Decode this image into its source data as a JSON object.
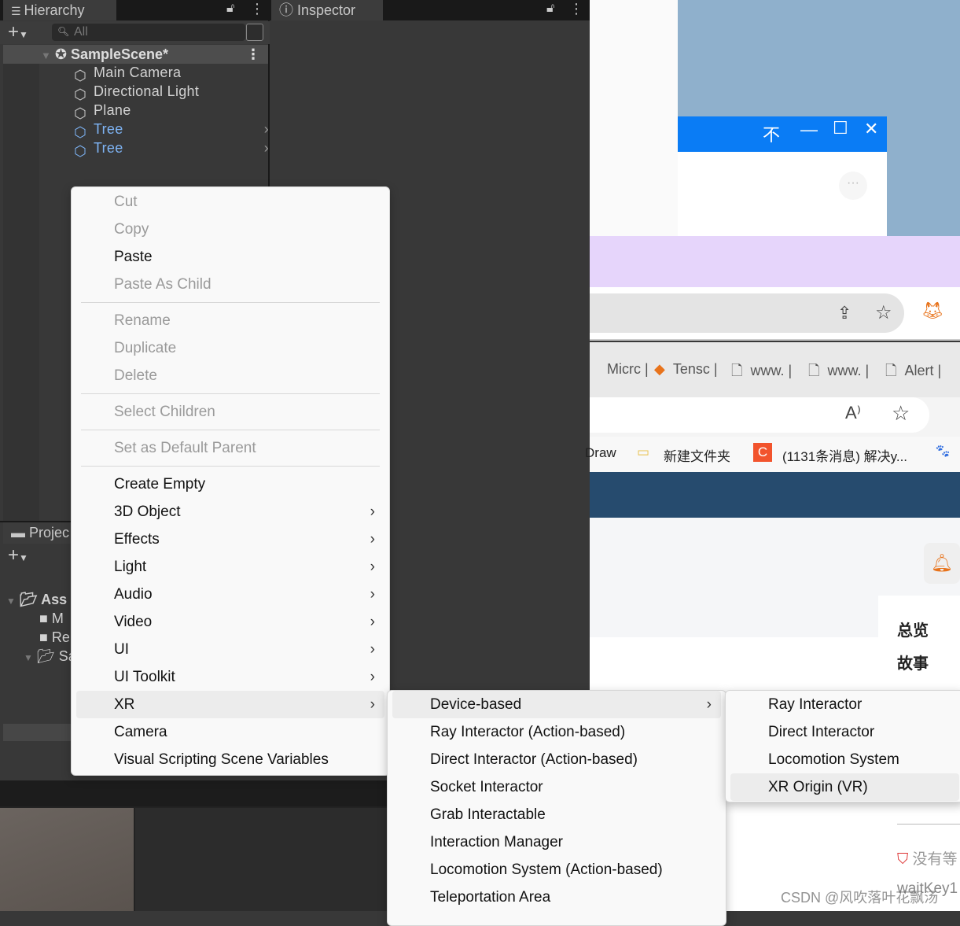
{
  "unity": {
    "hierarchy_tab": "Hierarchy",
    "inspector_tab": "Inspector",
    "search_placeholder": "All",
    "scene": "SampleScene*",
    "items": [
      {
        "label": "Main Camera",
        "prefab": false
      },
      {
        "label": "Directional Light",
        "prefab": false
      },
      {
        "label": "Plane",
        "prefab": false
      },
      {
        "label": "Tree",
        "prefab": true
      },
      {
        "label": "Tree",
        "prefab": true
      }
    ],
    "project_tab": "Projec",
    "project_items": [
      "Ass",
      "M",
      "Re",
      "Sa"
    ]
  },
  "context_menu": [
    {
      "label": "Cut",
      "disabled": true
    },
    {
      "label": "Copy",
      "disabled": true
    },
    {
      "label": "Paste"
    },
    {
      "label": "Paste As Child",
      "disabled": true
    },
    {
      "sep": true
    },
    {
      "label": "Rename",
      "disabled": true
    },
    {
      "label": "Duplicate",
      "disabled": true
    },
    {
      "label": "Delete",
      "disabled": true
    },
    {
      "sep": true
    },
    {
      "label": "Select Children",
      "disabled": true
    },
    {
      "sep": true
    },
    {
      "label": "Set as Default Parent",
      "disabled": true
    },
    {
      "sep": true
    },
    {
      "label": "Create Empty"
    },
    {
      "label": "3D Object",
      "submenu": true
    },
    {
      "label": "Effects",
      "submenu": true
    },
    {
      "label": "Light",
      "submenu": true
    },
    {
      "label": "Audio",
      "submenu": true
    },
    {
      "label": "Video",
      "submenu": true
    },
    {
      "label": "UI",
      "submenu": true
    },
    {
      "label": "UI Toolkit",
      "submenu": true
    },
    {
      "label": "XR",
      "submenu": true,
      "highlighted": true
    },
    {
      "label": "Camera"
    },
    {
      "label": "Visual Scripting Scene Variables"
    }
  ],
  "xr_menu": [
    {
      "label": "Device-based",
      "submenu": true,
      "highlighted": true
    },
    {
      "label": "Ray Interactor (Action-based)"
    },
    {
      "label": "Direct Interactor (Action-based)"
    },
    {
      "label": "Socket Interactor"
    },
    {
      "label": "Grab Interactable"
    },
    {
      "label": "Interaction Manager"
    },
    {
      "label": "Locomotion System (Action-based)"
    },
    {
      "label": "Teleportation Area"
    }
  ],
  "device_menu": [
    {
      "label": "Ray Interactor"
    },
    {
      "label": "Direct Interactor"
    },
    {
      "label": "Locomotion System"
    },
    {
      "label": "XR Origin (VR)",
      "highlighted": true
    }
  ],
  "browser": {
    "tabs": [
      "Micrc",
      "Tensc",
      "www.",
      "www.",
      "Alert"
    ],
    "bookmarks": [
      "Draw",
      "新建文件夹",
      "(1131条消息) 解决y..."
    ],
    "sidebar": [
      "总览",
      "故事"
    ],
    "badge_text": "没有等",
    "user": "waitKey1",
    "watermark": "CSDN @风吹落叶花飘汤"
  },
  "colors": {
    "window_blue": "#0a7cf5",
    "lavender": "#e6d5fb",
    "nav_dark": "#264b6e",
    "prefab_blue": "#7eb4f5"
  }
}
